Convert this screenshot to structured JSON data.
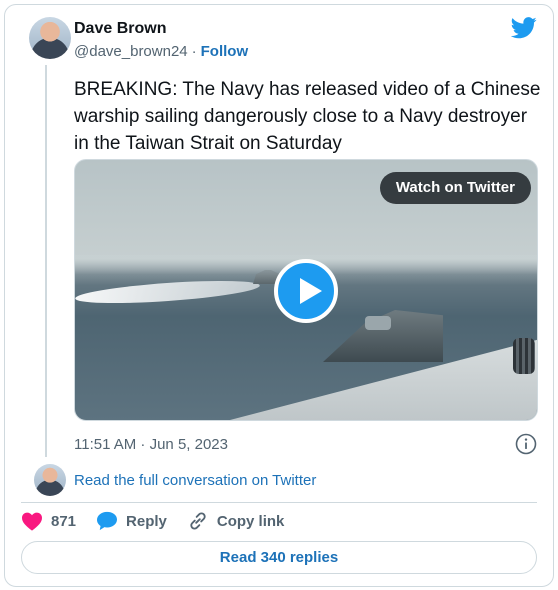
{
  "author": {
    "name": "Dave Brown",
    "handle": "@dave_brown24",
    "separator": "·",
    "follow_label": "Follow"
  },
  "tweet": {
    "text": "BREAKING: The Navy has released video of a Chinese warship sailing dangerously close to a Navy destroyer in the Taiwan Strait on Saturday",
    "timestamp": "11:51 AM · Jun 5, 2023"
  },
  "media": {
    "watch_label": "Watch on Twitter"
  },
  "conversation": {
    "read_full_label": "Read the full conversation on Twitter"
  },
  "actions": {
    "like_count": "871",
    "reply_label": "Reply",
    "copy_link_label": "Copy link"
  },
  "footer": {
    "read_replies_label": "Read 340 replies"
  },
  "icons": {
    "brand": "twitter-bird-icon",
    "like": "heart-icon",
    "reply": "speech-bubble-icon",
    "copy": "link-icon",
    "info": "info-icon",
    "play": "play-icon"
  },
  "colors": {
    "accent": "#1d9bf0",
    "link": "#1d72b8",
    "like": "#f91880",
    "muted": "#536471",
    "border": "#cfd9de"
  }
}
